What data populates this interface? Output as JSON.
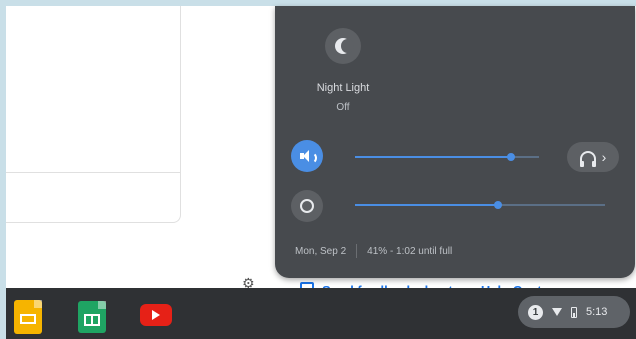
{
  "quick_settings": {
    "night_light": {
      "label": "Night Light",
      "state": "Off",
      "icon": "moon-icon"
    },
    "volume": {
      "icon": "speaker-icon",
      "level": 0.85
    },
    "audio_output": {
      "icon": "headphones-icon",
      "chevron": "›"
    },
    "brightness": {
      "icon": "brightness-icon",
      "level": 0.57
    },
    "footer": {
      "date": "Mon, Sep 2",
      "battery_status": "41% - 1:02 until full"
    }
  },
  "page": {
    "help_link": "Send feedback about our Help Center"
  },
  "shelf": {
    "apps": [
      {
        "name": "Google Slides",
        "icon": "slides-icon",
        "color": "#f6b400"
      },
      {
        "name": "Google Sheets",
        "icon": "sheets-icon",
        "color": "#1fa463"
      },
      {
        "name": "YouTube",
        "icon": "youtube-icon",
        "color": "#e62117"
      }
    ],
    "tray": {
      "notification_count": "1",
      "time": "5:13"
    }
  },
  "colors": {
    "accent": "#4a8ee4",
    "panel": "#474a4e",
    "shelf": "#2f3134"
  }
}
